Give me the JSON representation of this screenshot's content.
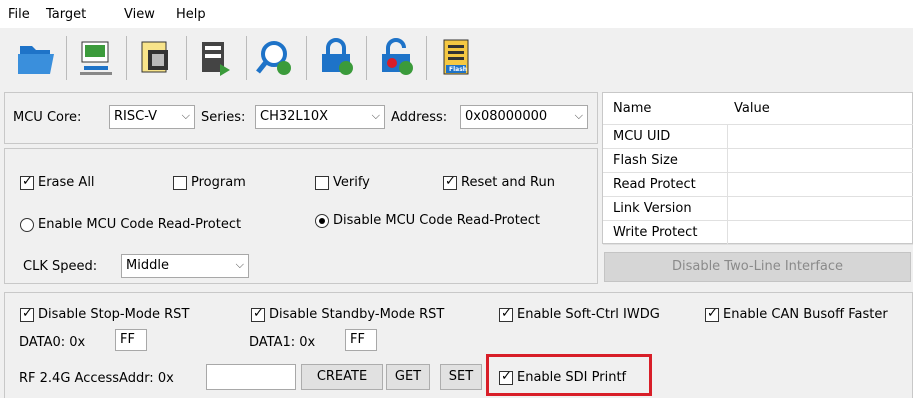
{
  "menu": [
    "File",
    "Target",
    "View",
    "Help"
  ],
  "toolbar": {
    "icons": [
      "open-file-icon",
      "connect-target-icon",
      "chip-config-icon",
      "download-icon",
      "query-icon",
      "lock-protect-icon",
      "unlock-protect-icon",
      "flash-icon"
    ],
    "flash_badge": "Flash"
  },
  "mcu": {
    "core_label": "MCU  Core:",
    "core_value": "RISC-V",
    "series_label": "Series:",
    "series_value": "CH32L10X",
    "address_label": "Address:",
    "address_value": "0x08000000"
  },
  "options": {
    "erase_all": "Erase All",
    "program": "Program",
    "verify": "Verify",
    "reset_and_run": "Reset and Run",
    "enable_read_protect": "Enable MCU Code Read-Protect",
    "disable_read_protect": "Disable MCU Code Read-Protect",
    "clk_label": "CLK Speed:",
    "clk_value": "Middle"
  },
  "table": {
    "headers": [
      "Name",
      "Value"
    ],
    "rows": [
      "MCU UID",
      "Flash Size",
      "Read Protect",
      "Link Version",
      "Write Protect"
    ]
  },
  "disable_two_line": "Disable Two-Line Interface",
  "bottom": {
    "disable_stop": "Disable Stop-Mode RST",
    "disable_standby": "Disable Standby-Mode RST",
    "enable_soft_iwdg": "Enable Soft-Ctrl IWDG",
    "enable_can": "Enable CAN Busoff Faster",
    "data0_label": "DATA0: 0x",
    "data0_value": "FF",
    "data1_label": "DATA1: 0x",
    "data1_value": "FF",
    "rf_label": "RF 2.4G AccessAddr: 0x",
    "rf_value": "",
    "create": "CREATE",
    "get": "GET",
    "set": "SET",
    "sdi_printf": "Enable SDI Printf"
  },
  "colors": {
    "highlight": "#d81e28",
    "accent_blue": "#1e73c8",
    "accent_green": "#3b9b3b"
  }
}
